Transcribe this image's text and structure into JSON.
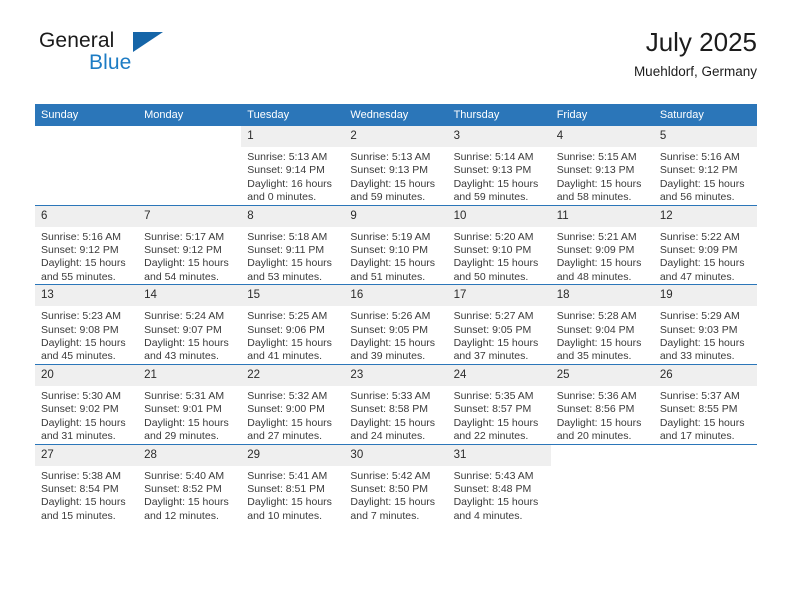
{
  "brand": {
    "name_part1": "General",
    "name_part2": "Blue",
    "triangle_icon": "triangle-icon",
    "accent_color": "#2b76b9",
    "logo_blue": "#1d7cc4"
  },
  "header": {
    "title": "July 2025",
    "subtitle": "Muehldorf, Germany"
  },
  "calendar": {
    "weekday_headers": [
      "Sunday",
      "Monday",
      "Tuesday",
      "Wednesday",
      "Thursday",
      "Friday",
      "Saturday"
    ],
    "labels": {
      "sunrise": "Sunrise:",
      "sunset": "Sunset:",
      "daylight": "Daylight:"
    },
    "weeks": [
      [
        {
          "day": "",
          "blank": true,
          "sunrise": "",
          "sunset": "",
          "daylight_line1": "",
          "daylight_line2": ""
        },
        {
          "day": "",
          "blank": true,
          "sunrise": "",
          "sunset": "",
          "daylight_line1": "",
          "daylight_line2": ""
        },
        {
          "day": "1",
          "sunrise": "Sunrise: 5:13 AM",
          "sunset": "Sunset: 9:14 PM",
          "daylight_line1": "Daylight: 16 hours",
          "daylight_line2": "and 0 minutes."
        },
        {
          "day": "2",
          "sunrise": "Sunrise: 5:13 AM",
          "sunset": "Sunset: 9:13 PM",
          "daylight_line1": "Daylight: 15 hours",
          "daylight_line2": "and 59 minutes."
        },
        {
          "day": "3",
          "sunrise": "Sunrise: 5:14 AM",
          "sunset": "Sunset: 9:13 PM",
          "daylight_line1": "Daylight: 15 hours",
          "daylight_line2": "and 59 minutes."
        },
        {
          "day": "4",
          "sunrise": "Sunrise: 5:15 AM",
          "sunset": "Sunset: 9:13 PM",
          "daylight_line1": "Daylight: 15 hours",
          "daylight_line2": "and 58 minutes."
        },
        {
          "day": "5",
          "sunrise": "Sunrise: 5:16 AM",
          "sunset": "Sunset: 9:12 PM",
          "daylight_line1": "Daylight: 15 hours",
          "daylight_line2": "and 56 minutes."
        }
      ],
      [
        {
          "day": "6",
          "sunrise": "Sunrise: 5:16 AM",
          "sunset": "Sunset: 9:12 PM",
          "daylight_line1": "Daylight: 15 hours",
          "daylight_line2": "and 55 minutes."
        },
        {
          "day": "7",
          "sunrise": "Sunrise: 5:17 AM",
          "sunset": "Sunset: 9:12 PM",
          "daylight_line1": "Daylight: 15 hours",
          "daylight_line2": "and 54 minutes."
        },
        {
          "day": "8",
          "sunrise": "Sunrise: 5:18 AM",
          "sunset": "Sunset: 9:11 PM",
          "daylight_line1": "Daylight: 15 hours",
          "daylight_line2": "and 53 minutes."
        },
        {
          "day": "9",
          "sunrise": "Sunrise: 5:19 AM",
          "sunset": "Sunset: 9:10 PM",
          "daylight_line1": "Daylight: 15 hours",
          "daylight_line2": "and 51 minutes."
        },
        {
          "day": "10",
          "sunrise": "Sunrise: 5:20 AM",
          "sunset": "Sunset: 9:10 PM",
          "daylight_line1": "Daylight: 15 hours",
          "daylight_line2": "and 50 minutes."
        },
        {
          "day": "11",
          "sunrise": "Sunrise: 5:21 AM",
          "sunset": "Sunset: 9:09 PM",
          "daylight_line1": "Daylight: 15 hours",
          "daylight_line2": "and 48 minutes."
        },
        {
          "day": "12",
          "sunrise": "Sunrise: 5:22 AM",
          "sunset": "Sunset: 9:09 PM",
          "daylight_line1": "Daylight: 15 hours",
          "daylight_line2": "and 47 minutes."
        }
      ],
      [
        {
          "day": "13",
          "sunrise": "Sunrise: 5:23 AM",
          "sunset": "Sunset: 9:08 PM",
          "daylight_line1": "Daylight: 15 hours",
          "daylight_line2": "and 45 minutes."
        },
        {
          "day": "14",
          "sunrise": "Sunrise: 5:24 AM",
          "sunset": "Sunset: 9:07 PM",
          "daylight_line1": "Daylight: 15 hours",
          "daylight_line2": "and 43 minutes."
        },
        {
          "day": "15",
          "sunrise": "Sunrise: 5:25 AM",
          "sunset": "Sunset: 9:06 PM",
          "daylight_line1": "Daylight: 15 hours",
          "daylight_line2": "and 41 minutes."
        },
        {
          "day": "16",
          "sunrise": "Sunrise: 5:26 AM",
          "sunset": "Sunset: 9:05 PM",
          "daylight_line1": "Daylight: 15 hours",
          "daylight_line2": "and 39 minutes."
        },
        {
          "day": "17",
          "sunrise": "Sunrise: 5:27 AM",
          "sunset": "Sunset: 9:05 PM",
          "daylight_line1": "Daylight: 15 hours",
          "daylight_line2": "and 37 minutes."
        },
        {
          "day": "18",
          "sunrise": "Sunrise: 5:28 AM",
          "sunset": "Sunset: 9:04 PM",
          "daylight_line1": "Daylight: 15 hours",
          "daylight_line2": "and 35 minutes."
        },
        {
          "day": "19",
          "sunrise": "Sunrise: 5:29 AM",
          "sunset": "Sunset: 9:03 PM",
          "daylight_line1": "Daylight: 15 hours",
          "daylight_line2": "and 33 minutes."
        }
      ],
      [
        {
          "day": "20",
          "sunrise": "Sunrise: 5:30 AM",
          "sunset": "Sunset: 9:02 PM",
          "daylight_line1": "Daylight: 15 hours",
          "daylight_line2": "and 31 minutes."
        },
        {
          "day": "21",
          "sunrise": "Sunrise: 5:31 AM",
          "sunset": "Sunset: 9:01 PM",
          "daylight_line1": "Daylight: 15 hours",
          "daylight_line2": "and 29 minutes."
        },
        {
          "day": "22",
          "sunrise": "Sunrise: 5:32 AM",
          "sunset": "Sunset: 9:00 PM",
          "daylight_line1": "Daylight: 15 hours",
          "daylight_line2": "and 27 minutes."
        },
        {
          "day": "23",
          "sunrise": "Sunrise: 5:33 AM",
          "sunset": "Sunset: 8:58 PM",
          "daylight_line1": "Daylight: 15 hours",
          "daylight_line2": "and 24 minutes."
        },
        {
          "day": "24",
          "sunrise": "Sunrise: 5:35 AM",
          "sunset": "Sunset: 8:57 PM",
          "daylight_line1": "Daylight: 15 hours",
          "daylight_line2": "and 22 minutes."
        },
        {
          "day": "25",
          "sunrise": "Sunrise: 5:36 AM",
          "sunset": "Sunset: 8:56 PM",
          "daylight_line1": "Daylight: 15 hours",
          "daylight_line2": "and 20 minutes."
        },
        {
          "day": "26",
          "sunrise": "Sunrise: 5:37 AM",
          "sunset": "Sunset: 8:55 PM",
          "daylight_line1": "Daylight: 15 hours",
          "daylight_line2": "and 17 minutes."
        }
      ],
      [
        {
          "day": "27",
          "sunrise": "Sunrise: 5:38 AM",
          "sunset": "Sunset: 8:54 PM",
          "daylight_line1": "Daylight: 15 hours",
          "daylight_line2": "and 15 minutes."
        },
        {
          "day": "28",
          "sunrise": "Sunrise: 5:40 AM",
          "sunset": "Sunset: 8:52 PM",
          "daylight_line1": "Daylight: 15 hours",
          "daylight_line2": "and 12 minutes."
        },
        {
          "day": "29",
          "sunrise": "Sunrise: 5:41 AM",
          "sunset": "Sunset: 8:51 PM",
          "daylight_line1": "Daylight: 15 hours",
          "daylight_line2": "and 10 minutes."
        },
        {
          "day": "30",
          "sunrise": "Sunrise: 5:42 AM",
          "sunset": "Sunset: 8:50 PM",
          "daylight_line1": "Daylight: 15 hours",
          "daylight_line2": "and 7 minutes."
        },
        {
          "day": "31",
          "sunrise": "Sunrise: 5:43 AM",
          "sunset": "Sunset: 8:48 PM",
          "daylight_line1": "Daylight: 15 hours",
          "daylight_line2": "and 4 minutes."
        },
        {
          "day": "",
          "blank": true,
          "sunrise": "",
          "sunset": "",
          "daylight_line1": "",
          "daylight_line2": ""
        },
        {
          "day": "",
          "blank": true,
          "sunrise": "",
          "sunset": "",
          "daylight_line1": "",
          "daylight_line2": ""
        }
      ]
    ]
  }
}
